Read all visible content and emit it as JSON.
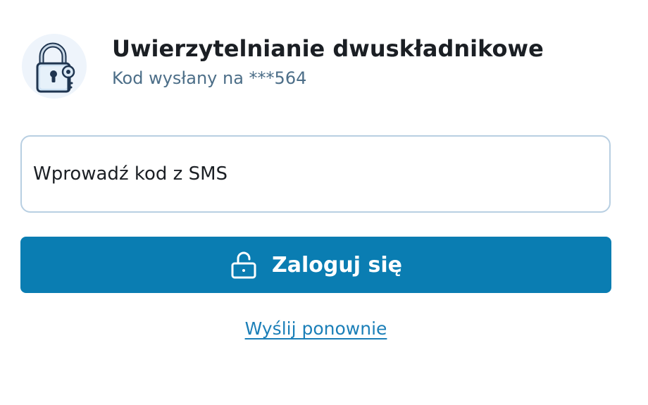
{
  "header": {
    "title": "Uwierzytelnianie dwuskładnikowe",
    "subtitle": "Kod wysłany na ***564",
    "logo_icon": "padlock-key-icon"
  },
  "form": {
    "code_placeholder": "Wprowadź kod z SMS",
    "code_value": ""
  },
  "login_button": {
    "label": "Zaloguj się",
    "icon": "unlock-icon"
  },
  "resend": {
    "label": "Wyślij ponownie"
  },
  "colors": {
    "primary": "#0a7db2",
    "link": "#1b7fb8",
    "subtitle": "#4c6e88",
    "input_border": "#b8cfe2"
  }
}
